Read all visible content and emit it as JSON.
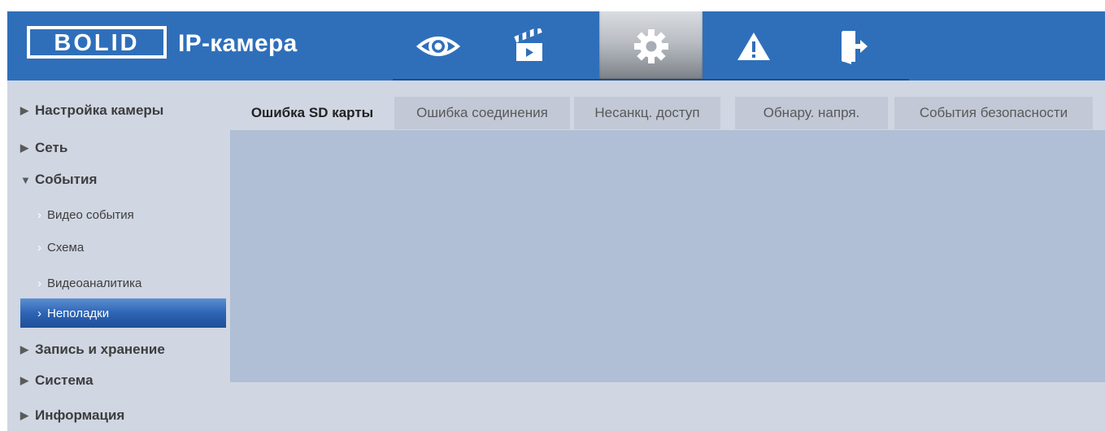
{
  "header": {
    "logo_text": "BOLID",
    "title": "IP-камера",
    "nav": [
      {
        "name": "live-view",
        "icon": "eye-icon"
      },
      {
        "name": "playback",
        "icon": "clapperboard-icon"
      },
      {
        "name": "settings",
        "icon": "gear-icon",
        "active": true
      },
      {
        "name": "alarm",
        "icon": "warning-icon"
      },
      {
        "name": "logout",
        "icon": "exit-icon"
      }
    ]
  },
  "sidebar": {
    "items": [
      {
        "label": "Настройка камеры",
        "expanded": false
      },
      {
        "label": "Сеть",
        "expanded": false
      },
      {
        "label": "События",
        "expanded": true,
        "children": [
          {
            "label": "Видео события"
          },
          {
            "label": "Схема"
          },
          {
            "label": "Видеоаналитика"
          },
          {
            "label": "Неполадки",
            "selected": true
          }
        ]
      },
      {
        "label": "Запись и хранение",
        "expanded": false
      },
      {
        "label": "Система",
        "expanded": false
      },
      {
        "label": "Информация",
        "expanded": false
      }
    ]
  },
  "tabs": [
    {
      "label": "Ошибка SD карты",
      "active": true
    },
    {
      "label": "Ошибка соединения"
    },
    {
      "label": "Несанкц. доступ"
    },
    {
      "label": "Обнару. напря."
    },
    {
      "label": "События безопасности"
    }
  ],
  "colors": {
    "header_bg": "#2f6fba",
    "page_bg": "#d0d6e2",
    "panel_bg": "#b0bfd6",
    "selected_item": "#2d64b4"
  }
}
